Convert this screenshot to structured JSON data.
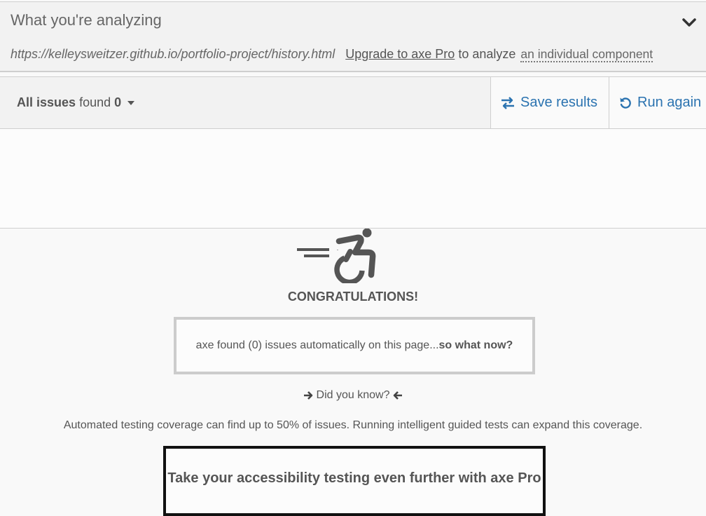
{
  "analyzing": {
    "title": "What you're analyzing",
    "url": "https://kelleysweitzer.github.io/portfolio-project/history.html",
    "upgrade_link": "Upgrade to axe Pro",
    "analyze_text": "to analyze",
    "component_link": "an individual component",
    "toggle_icon": "chevron-down-icon"
  },
  "toolbar": {
    "filter_label": "All issues",
    "filter_found": "found",
    "filter_count": "0",
    "save_label": "Save results",
    "run_label": "Run again",
    "save_icon": "swap-arrows-icon",
    "run_icon": "rotate-left-icon"
  },
  "results": {
    "hero_icon": "accessible-wheelchair-icon",
    "congrats": "CONGRATULATIONS!",
    "found_text": "axe found (0) issues automatically on this page...",
    "found_bold": "so what now?",
    "did_you_know": "Did you know?",
    "coverage": "Automated testing coverage can find up to 50% of issues. Running intelligent guided tests can expand this coverage.",
    "pro_title": "Take your accessibility testing even further with axe Pro"
  },
  "colors": {
    "link_blue": "#2b73b0",
    "text_gray": "#555555",
    "panel_bg": "#f2f2f2"
  }
}
